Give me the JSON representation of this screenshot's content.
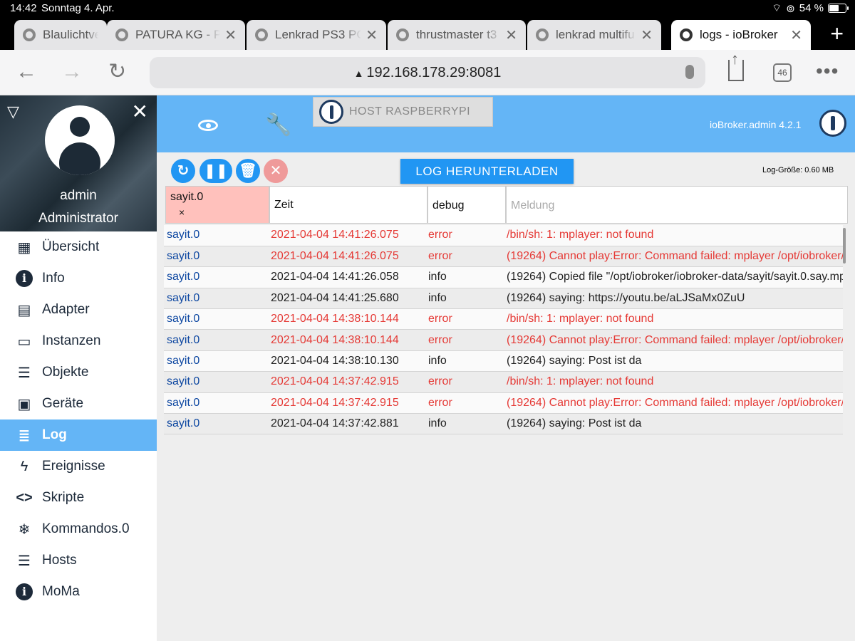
{
  "status": {
    "time": "14:42",
    "date": "Sonntag 4. Apr.",
    "battery": "54 %"
  },
  "tabs": [
    {
      "label": "Blaulichtve"
    },
    {
      "label": "PATURA KG - P"
    },
    {
      "label": "Lenkrad PS3 PC"
    },
    {
      "label": "thrustmaster t3"
    },
    {
      "label": "lenkrad multifu"
    },
    {
      "label": "logs - ioBroker"
    }
  ],
  "address": {
    "url": "192.168.178.29:8081",
    "tab_count": "46"
  },
  "profile": {
    "name": "admin",
    "role": "Administrator"
  },
  "menu": [
    {
      "label": "Übersicht",
      "icon": "grid-icon"
    },
    {
      "label": "Info",
      "icon": "info-icon"
    },
    {
      "label": "Adapter",
      "icon": "store-icon"
    },
    {
      "label": "Instanzen",
      "icon": "instances-icon"
    },
    {
      "label": "Objekte",
      "icon": "list-icon"
    },
    {
      "label": "Geräte",
      "icon": "devices-icon"
    },
    {
      "label": "Log",
      "icon": "log-icon",
      "active": true
    },
    {
      "label": "Ereignisse",
      "icon": "flash-icon"
    },
    {
      "label": "Skripte",
      "icon": "code-icon"
    },
    {
      "label": "Kommandos.0",
      "icon": "snowflake-icon"
    },
    {
      "label": "Hosts",
      "icon": "hosts-icon"
    },
    {
      "label": "MoMa",
      "icon": "info-icon"
    }
  ],
  "header": {
    "host": "HOST RASPBERRYPI",
    "version": "ioBroker.admin 4.2.1"
  },
  "toolbar": {
    "download_label": "LOG HERUNTERLADEN",
    "log_size": "Log-Größe: 0.60 MB"
  },
  "filters": {
    "source": "sayit.0",
    "source_clear": "×",
    "time": "Zeit",
    "level": "debug",
    "message_placeholder": "Meldung"
  },
  "logs": [
    {
      "source": "sayit.0",
      "time": "2021-04-04 14:41:26.075",
      "level": "error",
      "message": "/bin/sh: 1: mplayer: not found"
    },
    {
      "source": "sayit.0",
      "time": "2021-04-04 14:41:26.075",
      "level": "error",
      "message": "(19264) Cannot play:Error: Command failed: mplayer /opt/iobroker/i"
    },
    {
      "source": "sayit.0",
      "time": "2021-04-04 14:41:26.058",
      "level": "info",
      "message": "(19264) Copied file \"/opt/iobroker/iobroker-data/sayit/sayit.0.say.mp"
    },
    {
      "source": "sayit.0",
      "time": "2021-04-04 14:41:25.680",
      "level": "info",
      "message": "(19264) saying: https://youtu.be/aLJSaMx0ZuU"
    },
    {
      "source": "sayit.0",
      "time": "2021-04-04 14:38:10.144",
      "level": "error",
      "message": "/bin/sh: 1: mplayer: not found"
    },
    {
      "source": "sayit.0",
      "time": "2021-04-04 14:38:10.144",
      "level": "error",
      "message": "(19264) Cannot play:Error: Command failed: mplayer /opt/iobroker/c"
    },
    {
      "source": "sayit.0",
      "time": "2021-04-04 14:38:10.130",
      "level": "info",
      "message": "(19264) saying: Post ist da"
    },
    {
      "source": "sayit.0",
      "time": "2021-04-04 14:37:42.915",
      "level": "error",
      "message": "/bin/sh: 1: mplayer: not found"
    },
    {
      "source": "sayit.0",
      "time": "2021-04-04 14:37:42.915",
      "level": "error",
      "message": "(19264) Cannot play:Error: Command failed: mplayer /opt/iobroker/c"
    },
    {
      "source": "sayit.0",
      "time": "2021-04-04 14:37:42.881",
      "level": "info",
      "message": "(19264) saying: Post ist da"
    }
  ],
  "colors": {
    "accent": "#64b5f6",
    "button": "#2196f3",
    "error": "#e53935",
    "source_filter": "#ffc1bc"
  }
}
